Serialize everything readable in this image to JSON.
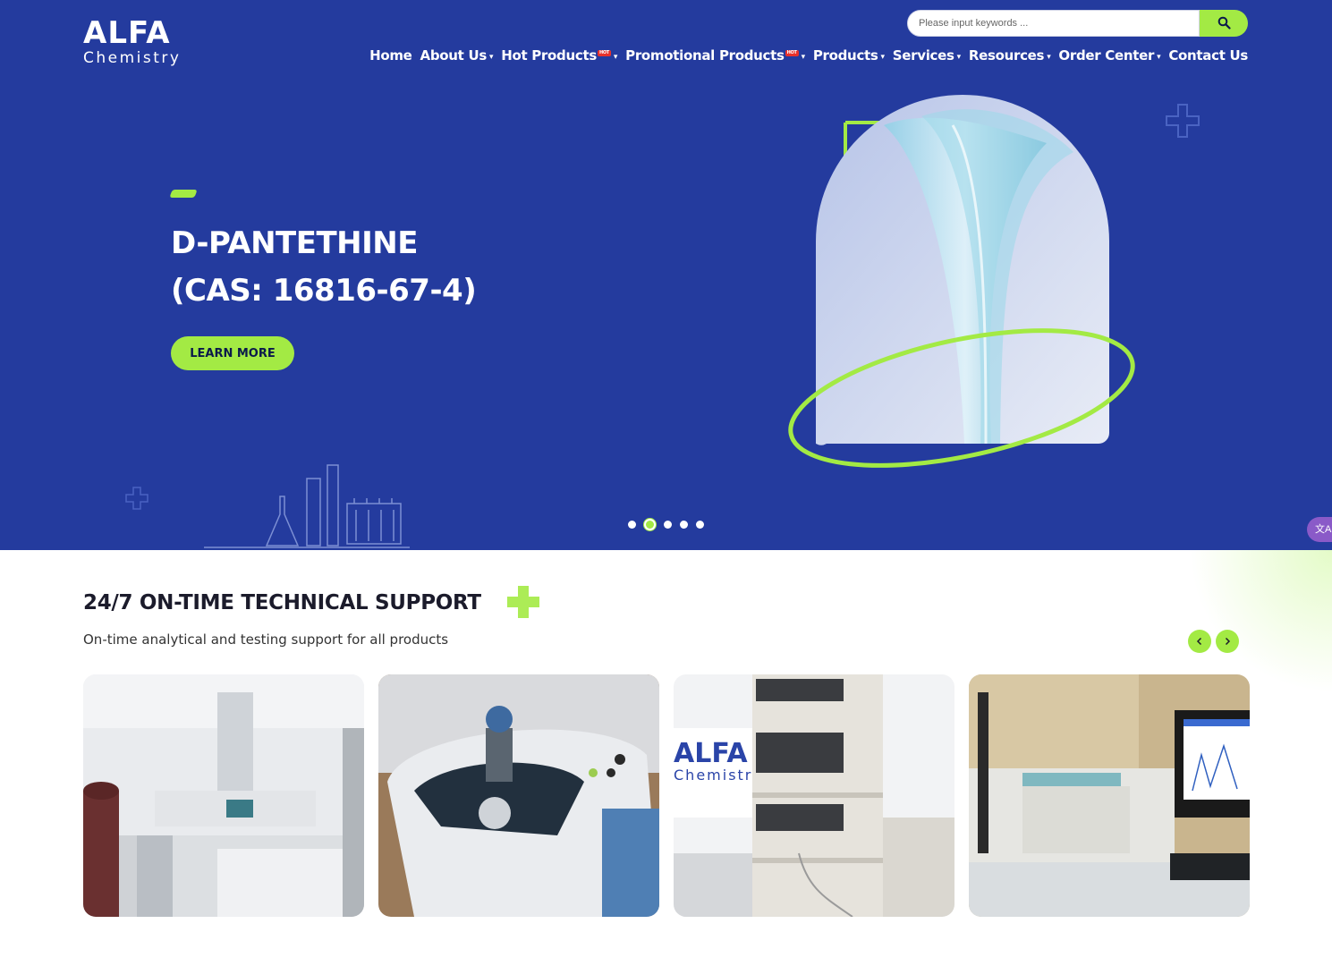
{
  "header": {
    "logo": {
      "top": "ALFA",
      "bottom": "Chemistry"
    },
    "search": {
      "placeholder": "Please input keywords ..."
    },
    "icons": {
      "search": "search-icon",
      "caret": "chevron-down-icon",
      "translate": "translate-icon"
    },
    "nav": [
      {
        "label": "Home",
        "caret": false,
        "hot": false
      },
      {
        "label": "About Us",
        "caret": true,
        "hot": false
      },
      {
        "label": "Hot Products",
        "caret": true,
        "hot": true
      },
      {
        "label": "Promotional Products",
        "caret": true,
        "hot": true
      },
      {
        "label": "Products",
        "caret": true,
        "hot": false
      },
      {
        "label": "Services",
        "caret": true,
        "hot": false
      },
      {
        "label": "Resources",
        "caret": true,
        "hot": false
      },
      {
        "label": "Order Center",
        "caret": true,
        "hot": false
      },
      {
        "label": "Contact Us",
        "caret": false,
        "hot": false
      }
    ],
    "hot_badge": "HOT"
  },
  "hero": {
    "title_line1": "D-PANTETHINE",
    "title_line2": "(CAS: 16816-67-4)",
    "button": "LEARN MORE",
    "slides_total": 5,
    "active_slide": 2
  },
  "support": {
    "title": "24/7 ON-TIME TECHNICAL SUPPORT",
    "subtitle": "On-time analytical and testing support for all products",
    "images": [
      {
        "name": "gas-chromatograph-photo"
      },
      {
        "name": "spectrometer-photo"
      },
      {
        "name": "hplc-system-photo",
        "logo_top": "ALFA",
        "logo_bottom": "Chemistry"
      },
      {
        "name": "microplate-reader-photo"
      }
    ]
  },
  "colors": {
    "brand_blue": "#243b9e",
    "accent_green": "#a3ea44",
    "hot_red": "#e8312b",
    "translate_purple": "#8a5ac8"
  }
}
